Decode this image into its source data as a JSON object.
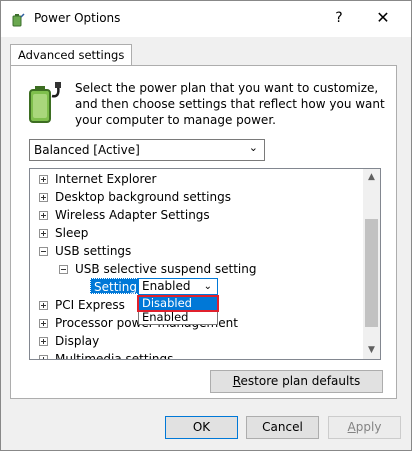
{
  "window": {
    "title": "Power Options",
    "help_label": "?",
    "close_label": "✕"
  },
  "tab": {
    "label": "Advanced settings"
  },
  "description": "Select the power plan that you want to customize, and then choose settings that reflect how you want your computer to manage power.",
  "plan_select": {
    "value": "Balanced [Active]"
  },
  "tree": {
    "items": [
      {
        "label": "Internet Explorer",
        "expanded": false
      },
      {
        "label": "Desktop background settings",
        "expanded": false
      },
      {
        "label": "Wireless Adapter Settings",
        "expanded": false
      },
      {
        "label": "Sleep",
        "expanded": false
      },
      {
        "label": "USB settings",
        "expanded": true
      },
      {
        "label": "USB selective suspend setting",
        "expanded": true
      },
      {
        "label": "PCI Express",
        "expanded": false
      },
      {
        "label": "Processor power management",
        "expanded": false
      },
      {
        "label": "Display",
        "expanded": false
      },
      {
        "label": "Multimedia settings",
        "expanded": false
      }
    ]
  },
  "setting": {
    "label": "Setting:",
    "value": "Enabled",
    "options": [
      "Disabled",
      "Enabled"
    ]
  },
  "buttons": {
    "restore_pre": "R",
    "restore_rest": "estore plan defaults",
    "ok": "OK",
    "cancel": "Cancel",
    "apply_pre": "A",
    "apply_rest": "pply"
  },
  "colors": {
    "accent": "#0078d7",
    "highlight": "#e0202c"
  }
}
